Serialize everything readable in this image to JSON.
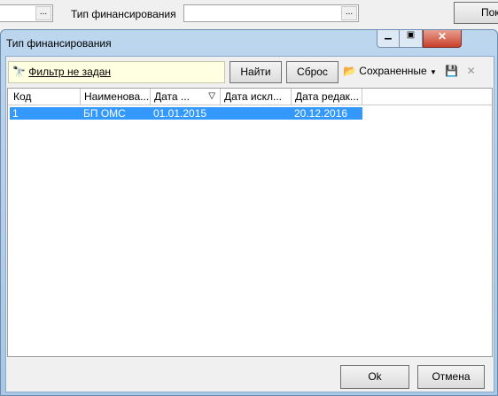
{
  "top": {
    "label": "Тип финансирования",
    "ellipsis": "...",
    "button": "Пок"
  },
  "dialog": {
    "title": "Тип финансирования",
    "filter": {
      "text": "Фильтр не задан",
      "icon": "binoculars-icon"
    },
    "find": "Найти",
    "reset": "Сброс",
    "saved": "Сохраненные",
    "columns": [
      "Код",
      "Наименова...",
      "Дата ...",
      "Дата искл...",
      "Дата редак..."
    ],
    "rows": [
      [
        "1",
        "БП ОМС",
        "01.01.2015",
        "",
        "20.12.2016"
      ]
    ],
    "ok": "Ok",
    "cancel": "Отмена"
  },
  "colors": {
    "selection": "#3399ff",
    "filter_bg": "#ffffe1"
  }
}
